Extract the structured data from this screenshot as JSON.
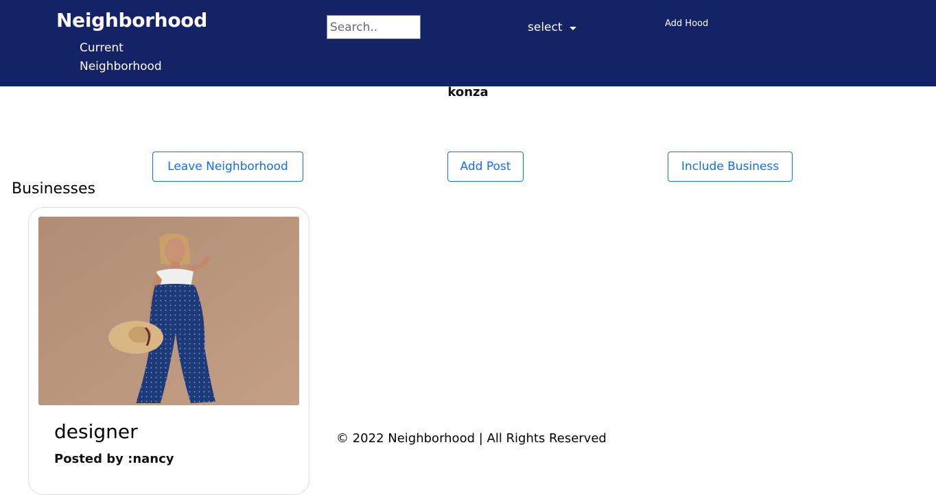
{
  "navbar": {
    "brand": "Neighborhood",
    "current_label": "Current Neighborhood",
    "search_placeholder": "Search..",
    "select_label": "select",
    "add_hood_label": "Add Hood"
  },
  "neighborhood": {
    "name": "konza"
  },
  "actions": {
    "leave_label": "Leave Neighborhood",
    "add_post_label": "Add Post",
    "include_business_label": "Include Business"
  },
  "businesses": {
    "section_title": "Businesses",
    "items": [
      {
        "title": "designer",
        "posted_by": "Posted by :nancy"
      }
    ]
  },
  "footer": {
    "text": "© 2022 Neighborhood | All Rights Reserved"
  },
  "colors": {
    "navbar_bg": "#142266",
    "accent": "#0d6efd"
  },
  "icons": {
    "dropdown": "chevron-down-icon"
  }
}
